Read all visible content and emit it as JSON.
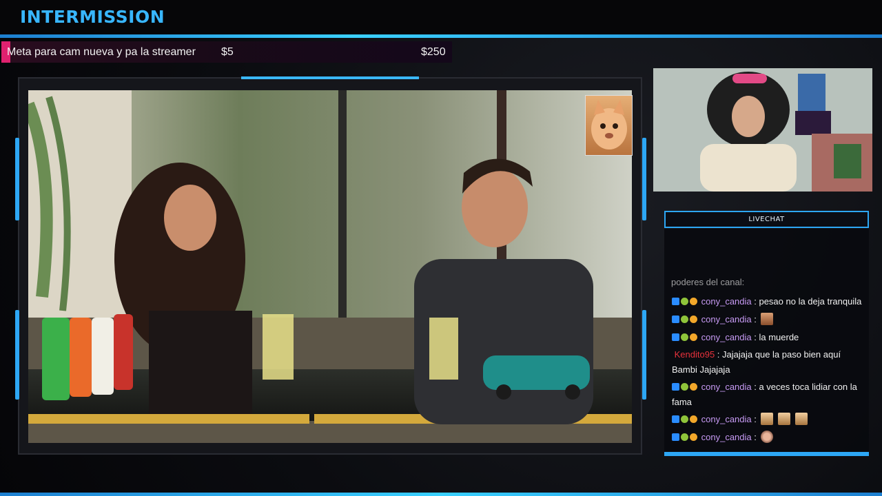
{
  "overlay": {
    "title": "INTERMISSION"
  },
  "goal": {
    "label": "Meta para cam nueva y pa la streamer",
    "current": "$5",
    "target": "$250",
    "progress": 0.02,
    "color": "#e0216f"
  },
  "chat": {
    "header": "LIVECHAT",
    "cutoff_text": "poderes del canal:",
    "messages": [
      {
        "user": "cony_candia",
        "text": "pesao no la deja tranquila",
        "badges": [
          "prime-icon",
          "sub-icon",
          "bits-icon"
        ],
        "emotes": []
      },
      {
        "user": "cony_candia",
        "text": "",
        "badges": [
          "prime-icon",
          "sub-icon",
          "bits-icon"
        ],
        "emotes": [
          "face-emote"
        ]
      },
      {
        "user": "cony_candia",
        "text": "la muerde",
        "badges": [
          "prime-icon",
          "sub-icon",
          "bits-icon"
        ],
        "emotes": []
      },
      {
        "user": "Kendito95",
        "text": "Jajajaja que la paso bien aquí Bambi Jajajaja",
        "badges": [],
        "emotes": []
      },
      {
        "user": "cony_candia",
        "text": "a veces toca lidiar con la fama",
        "badges": [
          "prime-icon",
          "sub-icon",
          "bits-icon"
        ],
        "emotes": []
      },
      {
        "user": "cony_candia",
        "text": "",
        "badges": [
          "prime-icon",
          "sub-icon",
          "bits-icon"
        ],
        "emotes": [
          "cat-emote",
          "cat-emote",
          "cat-emote"
        ]
      },
      {
        "user": "cony_candia",
        "text": "",
        "badges": [
          "prime-icon",
          "sub-icon",
          "bits-icon"
        ],
        "emotes": [
          "hand-emote"
        ]
      }
    ]
  },
  "colors": {
    "accent": "#2da7f5",
    "title": "#38b6ff",
    "username_sub": "#c79af4",
    "username_kendito": "#e8323c"
  }
}
